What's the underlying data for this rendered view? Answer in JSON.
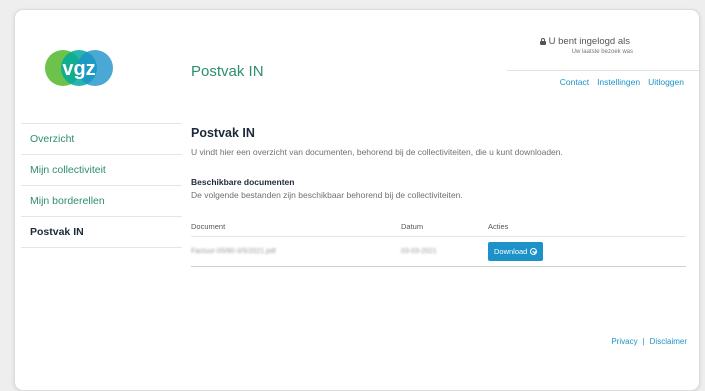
{
  "brand": {
    "logo_text": "VGZ",
    "green": "#2c8f6b",
    "blue": "#1d92c9"
  },
  "header": {
    "title": "Postvak IN",
    "account_label": "U bent ingelogd als",
    "last_visit": "Uw laatste bezoek was",
    "links": [
      "Contact",
      "Instellingen",
      "Uitloggen"
    ]
  },
  "sidebar": {
    "items": [
      {
        "label": "Overzicht",
        "active": false
      },
      {
        "label": "Mijn collectiviteit",
        "active": false
      },
      {
        "label": "Mijn borderellen",
        "active": false
      },
      {
        "label": "Postvak IN",
        "active": true
      }
    ]
  },
  "main": {
    "title": "Postvak IN",
    "intro": "U vindt hier een overzicht van documenten, behorend bij de collectiviteiten, die u kunt downloaden.",
    "section_title": "Beschikbare documenten",
    "section_desc": "De volgende bestanden zijn beschikbaar behorend bij de collectiviteiten.",
    "table": {
      "headers": [
        "Document",
        "Datum",
        "Acties"
      ],
      "rows": [
        {
          "document": "Factuur-05/90-3/5/2021.pdf",
          "date": "03-03-2021",
          "action": "Download",
          "action_icon": "download-circle-icon"
        }
      ]
    }
  },
  "footer": {
    "links": [
      "Privacy",
      "Disclaimer"
    ],
    "separator": "|"
  }
}
